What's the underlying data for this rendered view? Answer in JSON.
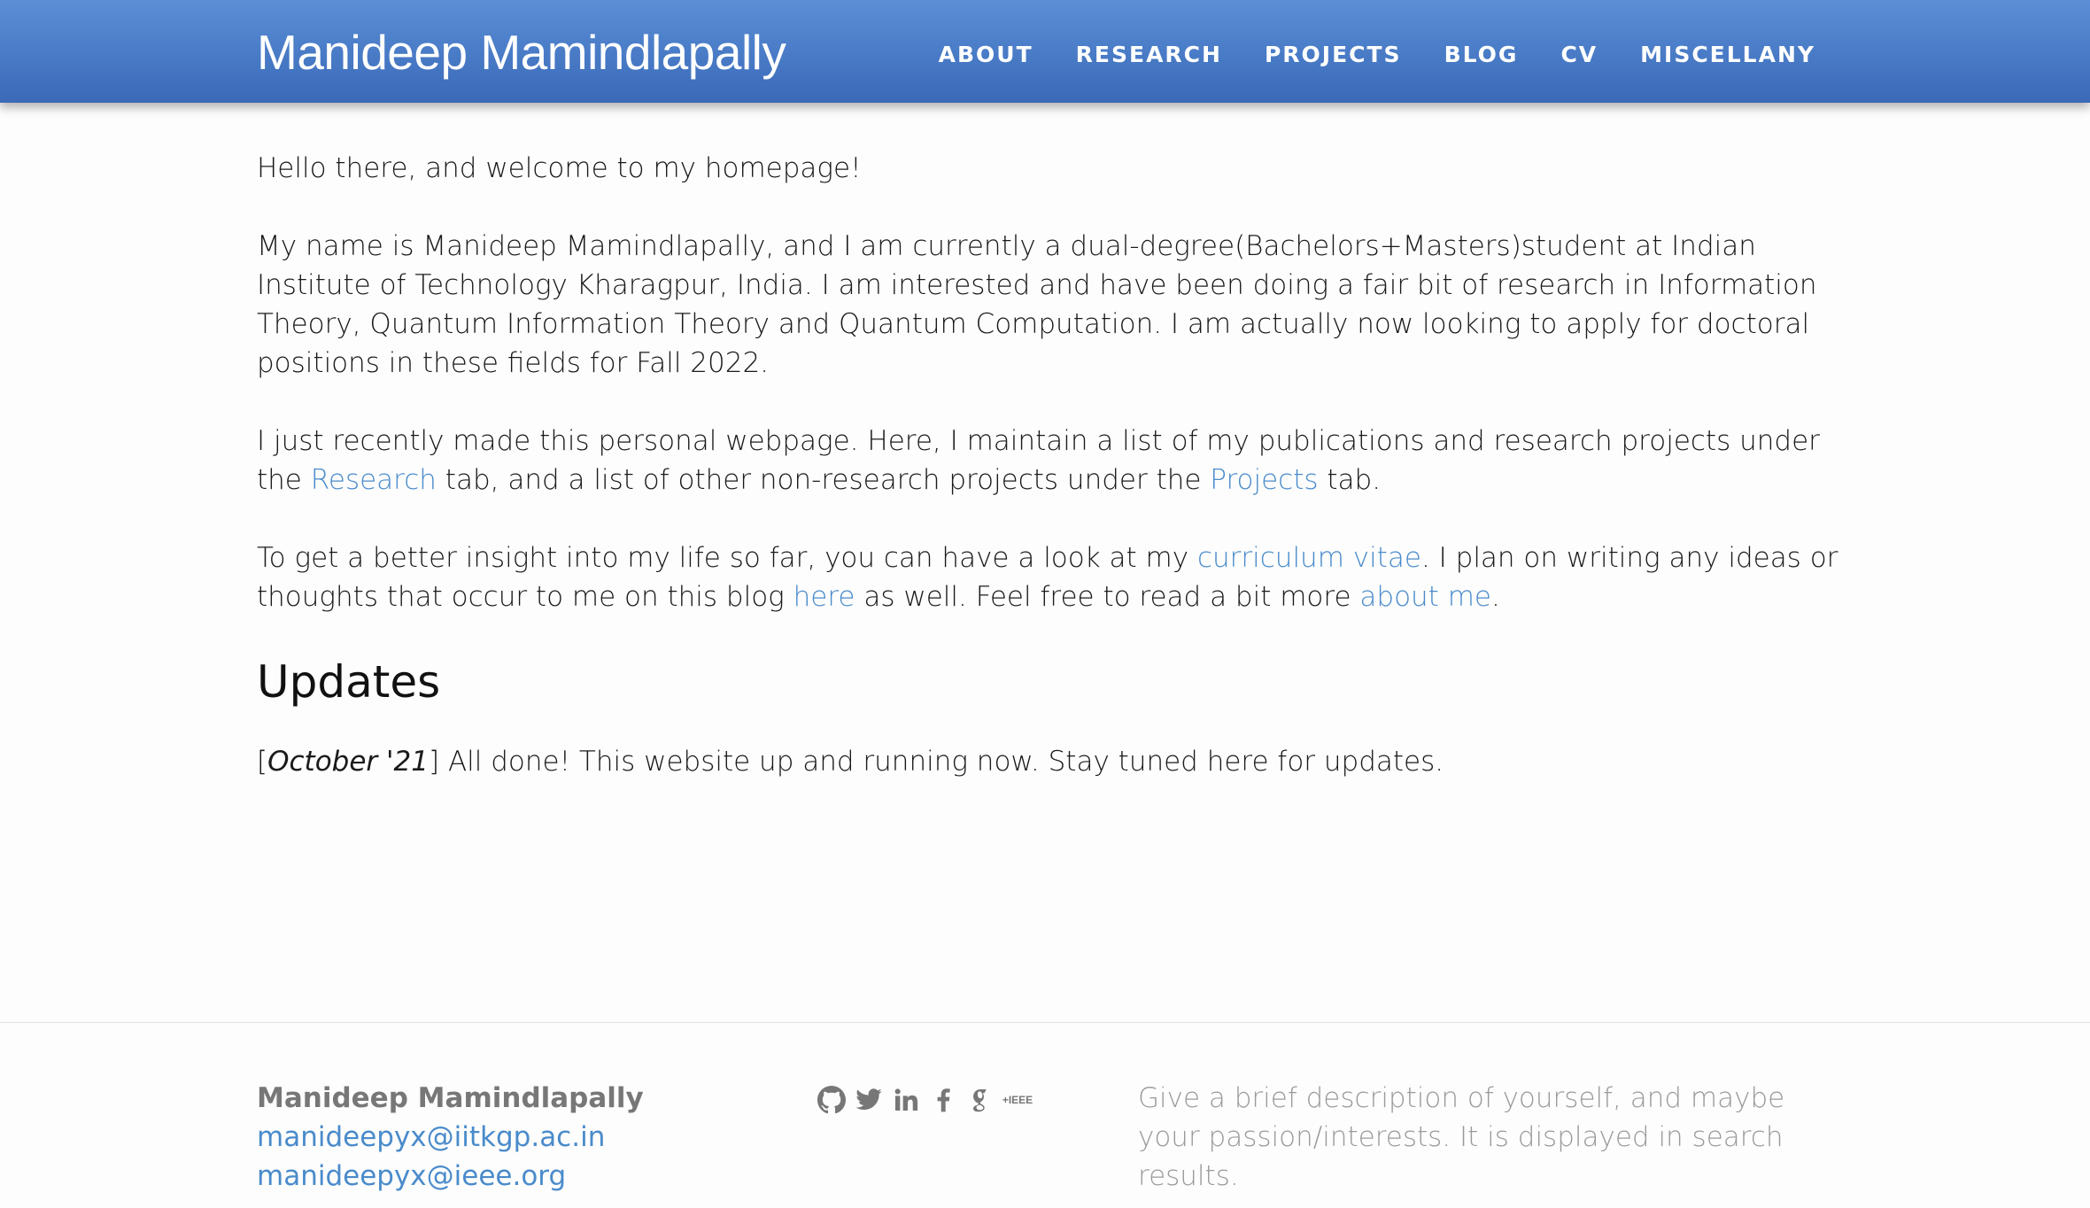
{
  "header": {
    "title": "Manideep Mamindlapally",
    "nav": [
      "ABOUT",
      "RESEARCH",
      "PROJECTS",
      "BLOG",
      "CV",
      "MISCELLANY"
    ]
  },
  "main": {
    "greeting": "Hello there, and welcome to my homepage!",
    "intro": "My name is Manideep Mamindlapally, and I am currently a dual-degree(Bachelors+Masters)student at Indian Institute of Technology Kharagpur, India. I am interested and have been doing a fair bit of research in Information Theory, Quantum Information Theory and Quantum Computation. I am actually now looking to apply for doctoral positions in these fields for Fall 2022.",
    "para2": {
      "t1": "I just recently made this personal webpage. Here, I maintain a list of my publications and research projects under the ",
      "link_research": "Research",
      "t2": " tab, and a list of other non-research projects under the ",
      "link_projects": "Projects",
      "t3": " tab."
    },
    "para3": {
      "t1": "To get a better insight into my life so far, you can have a look at my ",
      "link_cv": "curriculum vitae",
      "t2": ". I plan on writing any ideas or thoughts that occur to me on this blog ",
      "link_here": "here",
      "t3": " as well. Feel free to read a bit more ",
      "link_about": "about me",
      "t4": "."
    },
    "updates_heading": "Updates",
    "update": {
      "open": "[",
      "date": "October '21",
      "close": "]",
      "text": " All done! This website up and running now. Stay tuned here for updates."
    }
  },
  "footer": {
    "name": "Manideep Mamindlapally",
    "emails": [
      "manideepyx@iitkgp.ac.in",
      "manideepyx@ieee.org"
    ],
    "icons": [
      "github-icon",
      "twitter-icon",
      "linkedin-icon",
      "facebook-icon",
      "google-scholar-icon",
      "ieee-icon"
    ],
    "ieee_label": "+IEEE",
    "description": "Give a brief description of yourself, and maybe your passion/interests. It is displayed in search results."
  },
  "colors": {
    "nav_gradient_top": "#5a8fd6",
    "nav_gradient_bottom": "#3a69b8",
    "link": "#4a8bcb"
  }
}
